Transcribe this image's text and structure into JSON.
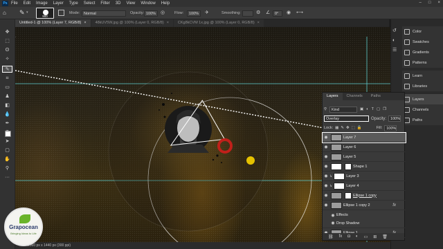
{
  "menu": {
    "app_icon": "Ps",
    "items": [
      "File",
      "Edit",
      "Image",
      "Layer",
      "Type",
      "Select",
      "Filter",
      "3D",
      "View",
      "Window",
      "Help"
    ],
    "window_controls": [
      "–",
      "□",
      "×"
    ]
  },
  "options_bar": {
    "brush_size": "900",
    "mode_label": "Mode:",
    "mode_value": "Normal",
    "opacity_label": "Opacity:",
    "opacity_value": "100%",
    "flow_label": "Flow:",
    "flow_value": "100%",
    "smoothing_label": "Smoothing:",
    "angle_value": "0°"
  },
  "tabs": [
    {
      "label": "Untitled-1 @ 100% (Layer 7, RGB/8)",
      "active": true
    },
    {
      "label": "48kUV5W.jpg @ 100% (Layer 0, RGB/8)",
      "active": false
    },
    {
      "label": "CKg8kCVM 1x.jpg @ 100% (Layer 0, RGB/8)",
      "active": false
    }
  ],
  "right_dock": {
    "group1": [
      "Color",
      "Swatches",
      "Gradients",
      "Patterns"
    ],
    "group2": [
      "Learn",
      "Libraries"
    ],
    "group3": [
      "Layers",
      "Channels",
      "Paths"
    ]
  },
  "layers_panel": {
    "tabs": [
      "Layers",
      "Channels",
      "Paths"
    ],
    "kind_label": "Kind",
    "blend_mode": "Overlay",
    "opacity_label": "Opacity:",
    "opacity_value": "100%",
    "lock_label": "Lock:",
    "fill_label": "Fill:",
    "fill_value": "100%",
    "layers": [
      {
        "name": "Layer 7",
        "selected": true
      },
      {
        "name": "Layer 6"
      },
      {
        "name": "Layer 5"
      },
      {
        "name": "Shape 1"
      },
      {
        "name": "Layer 3"
      },
      {
        "name": "Layer 4"
      },
      {
        "name": "Ellipse 1 copy"
      },
      {
        "name": "Ellipse 1 copy 2",
        "fx": "fx"
      },
      {
        "name": "Effects"
      },
      {
        "name": "Drop Shadow"
      },
      {
        "name": "Ellipse 1",
        "fx": "fx"
      }
    ]
  },
  "status_bar": {
    "text": "2560 px x 1440 px (300 ppi)"
  },
  "watermark": {
    "brand": "Grapocean",
    "tagline": "Bringing Ideas to Life"
  },
  "colors": {
    "accent_yellow": "#e6c200",
    "ring_red": "#c0201a",
    "guide_cyan": "#5fd0d0"
  }
}
